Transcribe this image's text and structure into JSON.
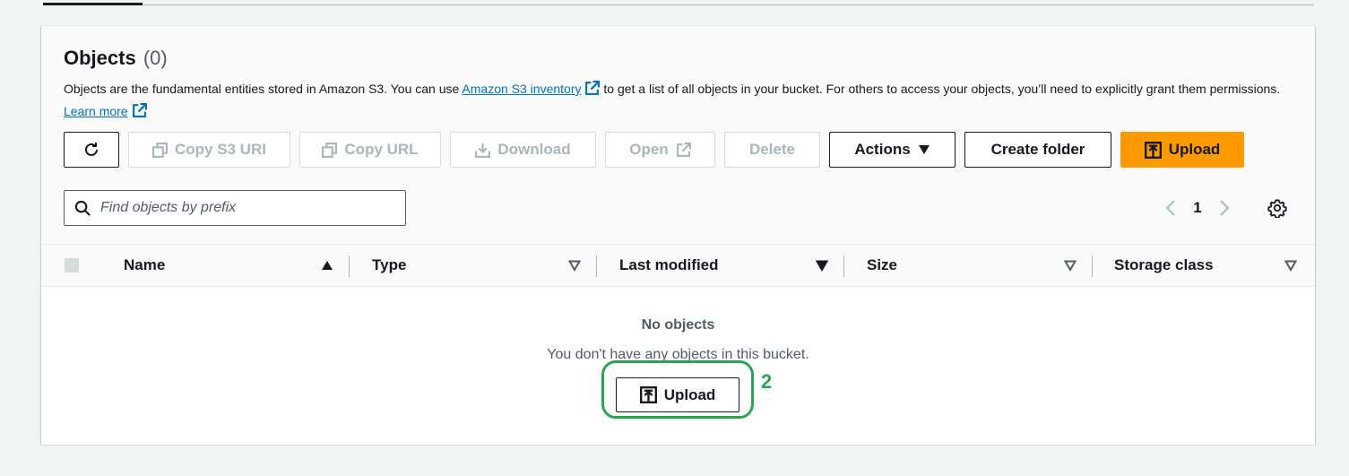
{
  "header": {
    "title": "Objects",
    "count": "(0)",
    "description_1": "Objects are the fundamental entities stored in Amazon S3. You can use",
    "inventory_link": "Amazon S3 inventory",
    "description_2": "to get a list of all objects in your bucket. For others to access your objects, you’ll need to explicitly grant them permissions.",
    "learn_more": "Learn more"
  },
  "toolbar": {
    "refresh_icon": "refresh-icon",
    "copy_s3_uri": "Copy S3 URI",
    "copy_url": "Copy URL",
    "download": "Download",
    "open": "Open",
    "delete": "Delete",
    "actions": "Actions",
    "create_folder": "Create folder",
    "upload": "Upload"
  },
  "search": {
    "placeholder": "Find objects by prefix"
  },
  "pagination": {
    "current_page": "1"
  },
  "table": {
    "columns": [
      "Name",
      "Type",
      "Last modified",
      "Size",
      "Storage class"
    ]
  },
  "empty_state": {
    "title": "No objects",
    "message": "You don't have any objects in this bucket.",
    "upload": "Upload"
  },
  "annotation": {
    "step_label": "2",
    "color": "#2ea44f"
  },
  "colors": {
    "primary": "#ff9900",
    "link": "#0073bb",
    "text": "#16191f",
    "disabled": "#aab7b8"
  }
}
